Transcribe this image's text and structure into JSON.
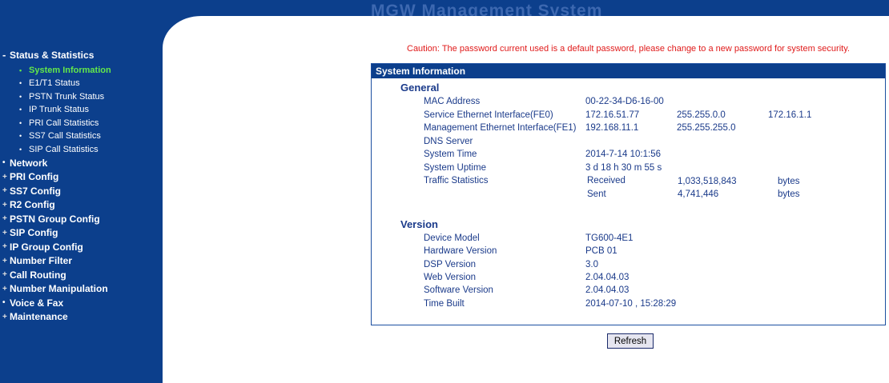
{
  "banner": {
    "text": "MGW Management System"
  },
  "sidebar": {
    "groups": [
      {
        "label": "Status & Statistics",
        "marker": "-",
        "expanded": true,
        "items": [
          {
            "label": "System Information",
            "active": true
          },
          {
            "label": "E1/T1 Status"
          },
          {
            "label": "PSTN Trunk Status"
          },
          {
            "label": "IP Trunk Status"
          },
          {
            "label": "PRI Call Statistics"
          },
          {
            "label": "SS7 Call Statistics"
          },
          {
            "label": "SIP Call Statistics"
          }
        ]
      },
      {
        "label": "Network",
        "marker": "•"
      },
      {
        "label": "PRI Config",
        "marker": "+"
      },
      {
        "label": "SS7 Config",
        "marker": "+"
      },
      {
        "label": "R2 Config",
        "marker": "+"
      },
      {
        "label": "PSTN Group Config",
        "marker": "+"
      },
      {
        "label": "SIP Config",
        "marker": "+"
      },
      {
        "label": "IP Group Config",
        "marker": "+"
      },
      {
        "label": "Number Filter",
        "marker": "+"
      },
      {
        "label": "Call Routing",
        "marker": "+"
      },
      {
        "label": "Number Manipulation",
        "marker": "+"
      },
      {
        "label": "Voice & Fax",
        "marker": "•"
      },
      {
        "label": "Maintenance",
        "marker": "+"
      }
    ]
  },
  "caution": "Caution: The password current used is a default password, please change to a new password for system security.",
  "panel": {
    "title": "System Information",
    "general": {
      "title": "General",
      "mac_label": "MAC Address",
      "mac_value": "00-22-34-D6-16-00",
      "fe0_label": "Service Ethernet Interface(FE0)",
      "fe0_ip": "172.16.51.77",
      "fe0_mask": "255.255.0.0",
      "fe0_gw": "172.16.1.1",
      "fe1_label": "Management Ethernet Interface(FE1)",
      "fe1_ip": "192.168.11.1",
      "fe1_mask": "255.255.255.0",
      "dns_label": "DNS Server",
      "time_label": "System Time",
      "time_value": "2014-7-14  10:1:56",
      "uptime_label": "System Uptime",
      "uptime_value": "3 d 18 h 30 m 55 s",
      "traffic_label": "Traffic Statistics",
      "received_label": "Received",
      "received_value": "1,033,518,843",
      "received_unit": "bytes",
      "sent_label": "Sent",
      "sent_value": "4,741,446",
      "sent_unit": "bytes"
    },
    "version": {
      "title": "Version",
      "model_label": "Device Model",
      "model_value": "TG600-4E1",
      "hw_label": "Hardware Version",
      "hw_value": "PCB 01",
      "dsp_label": "DSP Version",
      "dsp_value": "3.0",
      "web_label": "Web Version",
      "web_value": "2.04.04.03",
      "sw_label": "Software Version",
      "sw_value": "2.04.04.03",
      "built_label": "Time Built",
      "built_value": "2014-07-10 , 15:28:29"
    }
  },
  "refresh_label": "Refresh"
}
